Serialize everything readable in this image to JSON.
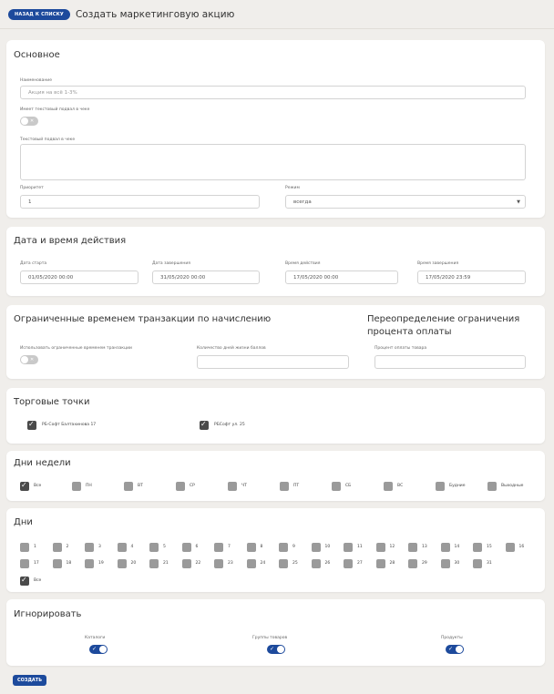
{
  "header": {
    "back_label": "НАЗАД К СПИСКУ",
    "title": "Создать маркетинговую акцию"
  },
  "basic": {
    "title": "Основное",
    "name_label": "Наименование",
    "name_placeholder": "Акция на всё 1-3%",
    "footer_toggle_label": "Имеет текстовый подвал в чеке",
    "footer_text_label": "Текстовый подвал в чеке",
    "priority_label": "Приоритет",
    "priority_value": "1",
    "mode_label": "Режим",
    "mode_value": "всегда"
  },
  "dates": {
    "title": "Дата и время действия",
    "start_label": "Дата старта",
    "start_value": "01/05/2020 00:00",
    "end_label": "Дата завершения",
    "end_value": "31/05/2020 00:00",
    "time_label": "Время действия",
    "time_value": "17/05/2020 00:00",
    "time_end_label": "Время завершения",
    "time_end_value": "17/05/2020 23:59"
  },
  "limits": {
    "title": "Ограниченные временем транзакции по начислению",
    "use_label": "Использовать ограниченные временем транзакции",
    "days_label": "Количество дней жизни баллов",
    "override_title_1": "Переопределение ограничения",
    "override_title_2": "процента оплаты",
    "percent_label": "Процент оплаты товара"
  },
  "stores": {
    "title": "Торговые точки",
    "items": [
      {
        "label": "РБ-Софт Балтахинова 17",
        "checked": true
      },
      {
        "label": "РБСофт ул. 25",
        "checked": true
      }
    ]
  },
  "weekdays": {
    "title": "Дни недели",
    "items": [
      {
        "label": "Все",
        "checked": true
      },
      {
        "label": "ПН",
        "checked": false
      },
      {
        "label": "ВТ",
        "checked": false
      },
      {
        "label": "СР",
        "checked": false
      },
      {
        "label": "ЧТ",
        "checked": false
      },
      {
        "label": "ПТ",
        "checked": false
      },
      {
        "label": "СБ",
        "checked": false
      },
      {
        "label": "ВС",
        "checked": false
      },
      {
        "label": "Будние",
        "checked": false
      },
      {
        "label": "Выходные",
        "checked": false
      }
    ]
  },
  "days": {
    "title": "Дни",
    "items": [
      "1",
      "2",
      "3",
      "4",
      "5",
      "6",
      "7",
      "8",
      "9",
      "10",
      "11",
      "12",
      "13",
      "14",
      "15",
      "16",
      "17",
      "18",
      "19",
      "20",
      "21",
      "22",
      "23",
      "24",
      "25",
      "26",
      "27",
      "28",
      "29",
      "30",
      "31"
    ],
    "all_label": "Все",
    "all_checked": true
  },
  "ignore": {
    "title": "Игнорировать",
    "items": [
      {
        "label": "Каталоги",
        "on": true
      },
      {
        "label": "Группы товаров",
        "on": true
      },
      {
        "label": "Продукты",
        "on": true
      }
    ]
  },
  "actions": {
    "create_label": "СОЗДАТЬ"
  },
  "colors": {
    "primary": "#1d4a9c",
    "page_bg": "#f0eeeb"
  },
  "icons": {
    "check": "check-icon",
    "caret": "caret-down-icon",
    "close": "close-icon"
  }
}
